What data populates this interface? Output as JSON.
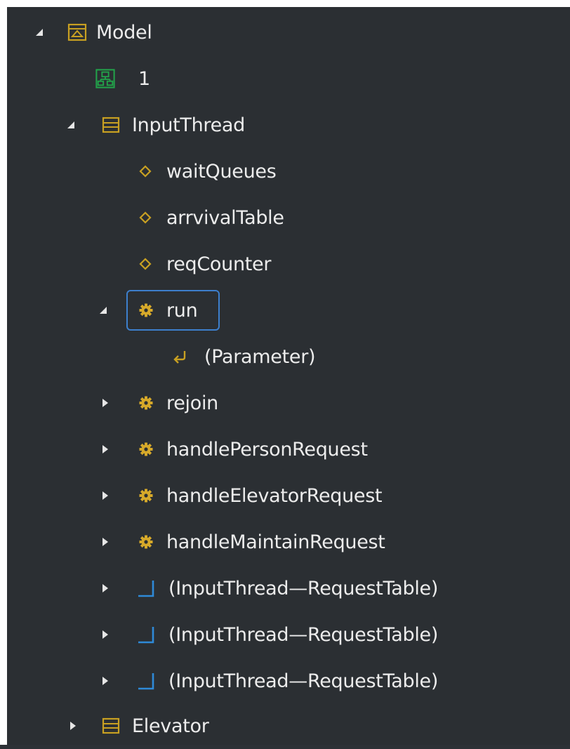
{
  "tree": {
    "model": {
      "label": "Model",
      "expanded": true
    },
    "diagram": {
      "label": "1"
    },
    "input_thread": {
      "label": "InputThread",
      "expanded": true,
      "attributes": [
        "waitQueues",
        "arrvivalTable",
        "reqCounter"
      ],
      "run": {
        "label": "run",
        "expanded": true,
        "parameter": "(Parameter)"
      },
      "operations": [
        "rejoin",
        "handlePersonRequest",
        "handleElevatorRequest",
        "handleMaintainRequest"
      ],
      "associations": [
        "(InputThread—RequestTable)",
        "(InputThread—RequestTable)",
        "(InputThread—RequestTable)"
      ]
    },
    "elevator": {
      "label": "Elevator",
      "expanded": false
    }
  },
  "colors": {
    "background": "#2b2f33",
    "text": "#ececec",
    "accent_gold": "#c8a022",
    "diagram_green": "#22a24a",
    "association_blue": "#2e8ad8",
    "focus_border": "#3d7fcc"
  }
}
